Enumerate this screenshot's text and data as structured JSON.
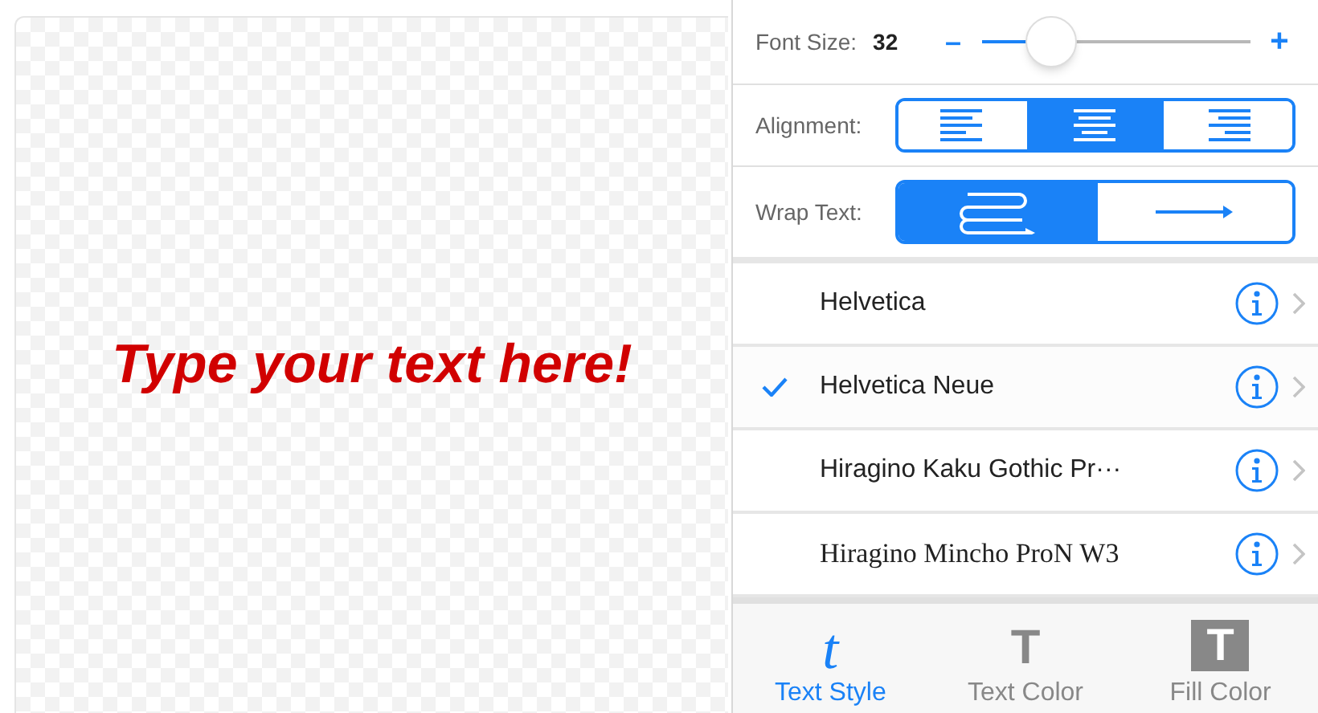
{
  "canvas": {
    "text": "Type your text here!"
  },
  "font_size": {
    "label": "Font Size:",
    "value": "32",
    "minus": "–",
    "plus": "+",
    "level": 0.26
  },
  "alignment": {
    "label": "Alignment:",
    "options": [
      {
        "kind": "left",
        "selected": false
      },
      {
        "kind": "center",
        "selected": true
      },
      {
        "kind": "right",
        "selected": false
      }
    ]
  },
  "wrap_text": {
    "label": "Wrap Text:",
    "options": [
      {
        "kind": "wrap",
        "selected": true
      },
      {
        "kind": "nowrap",
        "selected": false
      }
    ]
  },
  "fonts": [
    {
      "name": "Helvetica",
      "kind": "sans",
      "selected": false
    },
    {
      "name": "Helvetica Neue",
      "kind": "sans",
      "selected": true
    },
    {
      "name": "Hiragino Kaku Gothic Pr···",
      "kind": "sans",
      "selected": false
    },
    {
      "name": "Hiragino Mincho ProN W3",
      "kind": "serif",
      "selected": false
    }
  ],
  "tabs": [
    {
      "glyph": "t",
      "kind": "italic",
      "label": "Text Style",
      "selected": true
    },
    {
      "glyph": "T",
      "kind": "plain",
      "label": "Text Color",
      "selected": false
    },
    {
      "glyph": "T",
      "kind": "boxed",
      "label": "Fill Color",
      "selected": false
    }
  ]
}
